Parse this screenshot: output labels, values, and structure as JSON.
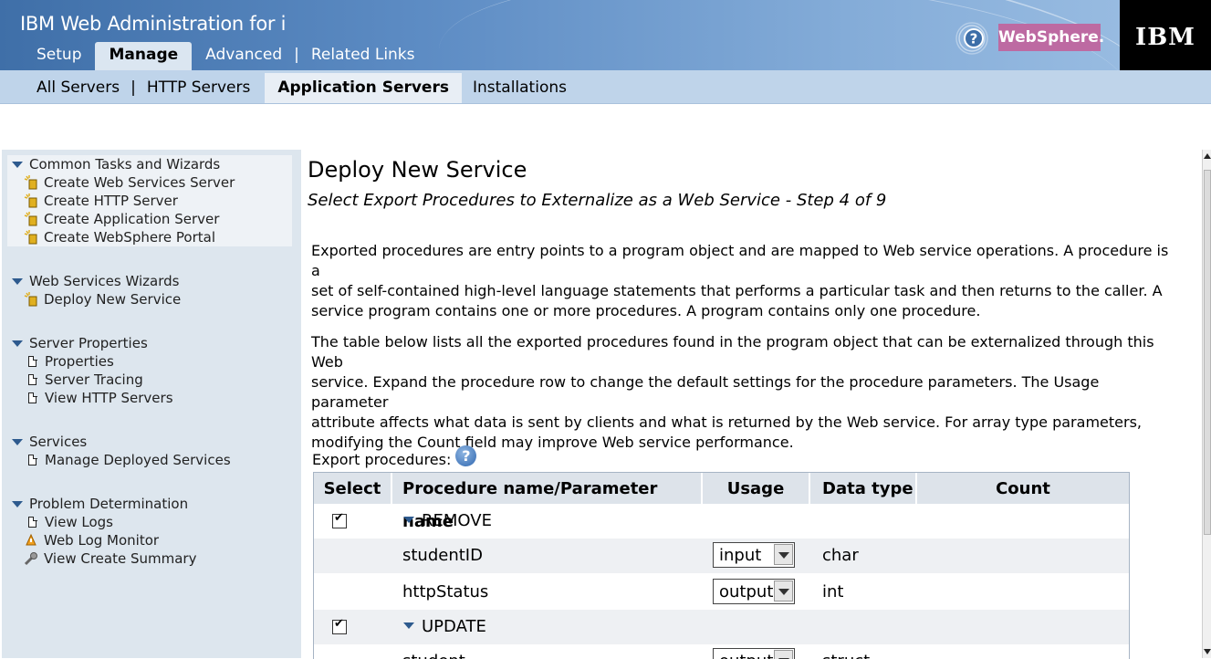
{
  "header": {
    "title": "IBM Web Administration for i",
    "tabs": [
      {
        "label": "Setup"
      },
      {
        "label": "Manage"
      },
      {
        "label": "Advanced"
      },
      {
        "label": "Related Links"
      }
    ],
    "active_tab": "Manage",
    "brand_badge": "WebSphere.",
    "logo_text": "IBM",
    "badge_color": "#bd6aa2"
  },
  "subnav": {
    "tabs": [
      {
        "label": "All Servers"
      },
      {
        "label": "HTTP Servers"
      },
      {
        "label": "Application Servers"
      },
      {
        "label": "Installations"
      }
    ],
    "active_tab": "Application Servers"
  },
  "sidebar": {
    "groups": [
      {
        "title": "Common Tasks and Wizards",
        "items": [
          {
            "label": "Create Web Services Server",
            "icon": "wizard-icon"
          },
          {
            "label": "Create HTTP Server",
            "icon": "wizard-icon"
          },
          {
            "label": "Create Application Server",
            "icon": "wizard-icon"
          },
          {
            "label": "Create WebSphere Portal",
            "icon": "wizard-icon"
          }
        ]
      },
      {
        "title": "Web Services Wizards",
        "items": [
          {
            "label": "Deploy New Service",
            "icon": "wizard-icon"
          }
        ]
      },
      {
        "title": "Server Properties",
        "items": [
          {
            "label": "Properties",
            "icon": "page-icon"
          },
          {
            "label": "Server Tracing",
            "icon": "page-icon"
          },
          {
            "label": "View HTTP Servers",
            "icon": "page-icon"
          }
        ]
      },
      {
        "title": "Services",
        "items": [
          {
            "label": "Manage Deployed Services",
            "icon": "page-icon"
          }
        ]
      },
      {
        "title": "Problem Determination",
        "items": [
          {
            "label": "View Logs",
            "icon": "page-icon"
          },
          {
            "label": "Web Log Monitor",
            "icon": "monitor-icon"
          },
          {
            "label": "View Create Summary",
            "icon": "wrench-icon"
          }
        ]
      }
    ]
  },
  "main": {
    "title": "Deploy New Service",
    "subtitle": "Select Export Procedures to Externalize as a Web Service - Step 4 of 9",
    "paragraph1_lines": [
      "Exported procedures are entry points to a program object and are mapped to Web service operations. A procedure is a",
      "set of self-contained high-level language statements that performs a particular task and then returns to the caller. A",
      "service program contains one or more procedures. A program contains only one procedure."
    ],
    "paragraph2_lines": [
      "The table below lists all the exported procedures found in the program object that can be externalized through this Web",
      "service. Expand the procedure row to change the default settings for the procedure parameters. The Usage parameter",
      "attribute affects what data is sent by clients and what is returned by the Web service. For array type parameters,",
      "modifying the Count field may improve Web service performance."
    ],
    "export_label": "Export procedures:",
    "table": {
      "headers": {
        "select": "Select",
        "name": "Procedure name/Parameter name",
        "usage": "Usage",
        "datatype": "Data type",
        "count": "Count"
      },
      "rows": [
        {
          "type": "procedure",
          "name": "REMOVE",
          "checked": true
        },
        {
          "type": "param",
          "name": "studentID",
          "usage": "input",
          "datatype": "char"
        },
        {
          "type": "param",
          "name": "httpStatus",
          "usage": "output",
          "datatype": "int"
        },
        {
          "type": "procedure",
          "name": "UPDATE",
          "checked": true
        },
        {
          "type": "param",
          "name": "student",
          "usage": "output",
          "datatype": "struct"
        }
      ]
    }
  }
}
